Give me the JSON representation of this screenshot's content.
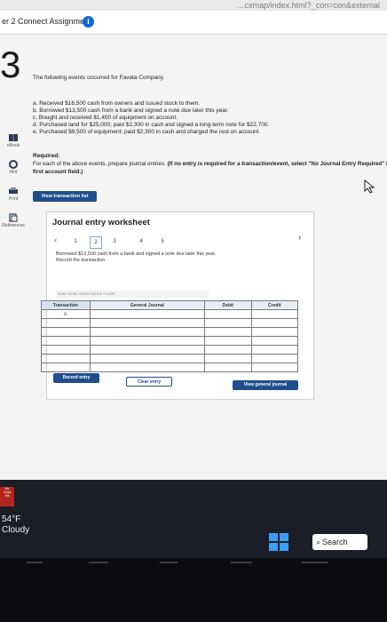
{
  "browser": {
    "url_fragment": "…cxmap/index.html?_con=con&external",
    "tab_title": "er 2 Connect Assignment"
  },
  "question_number": "3",
  "sidebar": {
    "items": [
      {
        "label": "eBook",
        "icon": "book-icon"
      },
      {
        "label": "Hint",
        "icon": "lifebuoy-icon"
      },
      {
        "label": "Print",
        "icon": "print-icon"
      },
      {
        "label": "References",
        "icon": "references-icon"
      }
    ]
  },
  "problem": {
    "intro": "The following events occurred for Favata Company.",
    "events": [
      "a. Received $16,500 cash from owners and issued stock to them.",
      "b. Borrowed $13,500 cash from a bank and signed a note due later this year.",
      "c. Bought and received $1,450 of equipment on account.",
      "d. Purchased land for $25,000; paid $2,300 in cash and signed a long-term note for $22,700.",
      "e. Purchased $9,500 of equipment; paid $2,300 in cash and charged the rest on account."
    ],
    "required_title": "Required:",
    "required_text": "For each of the above events, prepare journal entries.",
    "required_bold": "(If no entry is required for a transaction/event, select \"No Journal Entry Required\" in the first account field.)"
  },
  "buttons": {
    "view_transaction_list": "View transaction list",
    "record_entry": "Record entry",
    "clear_entry": "Clear entry",
    "view_general_journal": "View general journal"
  },
  "worksheet": {
    "title": "Journal entry worksheet",
    "pages": [
      "1",
      "2",
      "3",
      "4",
      "5"
    ],
    "active_page": "2",
    "instruction_1": "Borrowed $13,500 cash from a bank and signed a note due later this year.",
    "instruction_2": "Record the transaction.",
    "note": "Note: Enter debits before credits.",
    "table": {
      "headers": [
        "Transaction",
        "General Journal",
        "Debit",
        "Credit"
      ],
      "transaction_label": "b"
    }
  },
  "taskbar": {
    "temperature": "54°F",
    "condition": "Cloudy",
    "search_label": "Search"
  },
  "colors": {
    "accent": "#1f4e8c",
    "info_icon": "#1266d6",
    "table_header": "#e9eef5"
  }
}
